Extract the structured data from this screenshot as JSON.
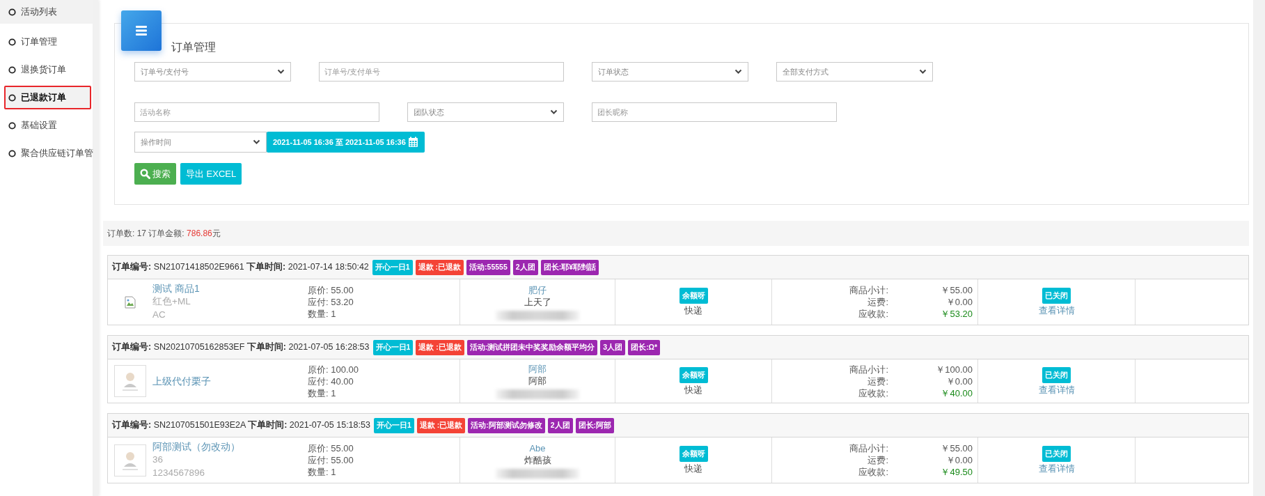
{
  "sidebar": {
    "items": [
      {
        "label": "活动列表",
        "selected": false,
        "hovered": true
      },
      {
        "label": "订单管理",
        "selected": false,
        "hovered": false
      },
      {
        "label": "退换货订单",
        "selected": false,
        "hovered": false
      },
      {
        "label": "已退款订单",
        "selected": true,
        "hovered": false
      },
      {
        "label": "基础设置",
        "selected": false,
        "hovered": false
      },
      {
        "label": "聚合供应链订单管",
        "selected": false,
        "hovered": false
      }
    ]
  },
  "filter_panel": {
    "title": "订单管理",
    "rows": [
      {
        "fields": [
          {
            "kind": "select",
            "placeholder": "订单号/支付号"
          },
          {
            "kind": "input",
            "placeholder": "订单号/支付单号"
          },
          {
            "kind": "select",
            "placeholder": "订单状态"
          },
          {
            "kind": "select",
            "placeholder": "全部支付方式"
          }
        ]
      },
      {
        "fields": [
          {
            "kind": "input",
            "placeholder": "活动名称"
          },
          {
            "kind": "select",
            "placeholder": "团队状态"
          },
          {
            "kind": "input",
            "placeholder": "团长昵称"
          }
        ]
      },
      {
        "fields": [
          {
            "kind": "time-select",
            "placeholder": "操作时间"
          },
          {
            "kind": "date-range",
            "placeholder": "2021-11-05 16:36 至 2021-11-05 16:36"
          }
        ]
      }
    ],
    "buttons": [
      {
        "kind": "search",
        "label": "搜索"
      },
      {
        "kind": "export",
        "label": "导出 EXCEL"
      }
    ]
  },
  "summary": {
    "count_label": "订单数:",
    "count": "17",
    "amount_label": "订单金额:",
    "amount": "786.86",
    "unit": "元"
  },
  "orders": [
    {
      "header": "**订单编号:** SN21071418502E9661 **下单时间:** 2021-07-14 18:50:42",
      "tags": [
        {
          "text": "开心一日1",
          "color": "#00bcd4"
        },
        {
          "text": "退款 :已退款",
          "color": "#f44336"
        },
        {
          "text": "活动:55555",
          "color": "#9c27b0"
        },
        {
          "text": "2人团",
          "color": "#9c27b0"
        },
        {
          "text": "团长:耶¥耶剉話",
          "color": "#9c27b0"
        }
      ],
      "image": {
        "kind": "broken"
      },
      "product": {
        "name": "测试 商品1",
        "details": [
          "红色+ML",
          "AC"
        ]
      },
      "prices": [
        "原价: 55.00",
        "应付: 53.20",
        "数量: 1"
      ],
      "buyer": {
        "name": "肥仔",
        "nickname": "上天了",
        "redacted": true
      },
      "payment": {
        "badge": "余额呀",
        "delivery": "快递"
      },
      "totals": {
        "subtotal": {
          "label": "商品小计:",
          "value": "￥55.00"
        },
        "shipping": {
          "label": "运费:",
          "value": "￥0.00"
        },
        "receivable": {
          "label": "应收款:",
          "value": "￥53.20"
        }
      },
      "status": {
        "badge": "已关闭",
        "link": "查看详情"
      }
    },
    {
      "header": "**订单编号:** SN20210705162853EF **下单时间:** 2021-07-05 16:28:53",
      "tags": [
        {
          "text": "开心一日1",
          "color": "#00bcd4"
        },
        {
          "text": "退款 :已退款",
          "color": "#f44336"
        },
        {
          "text": "活动:测试拼团未中奖奖励余额平均分",
          "color": "#9c27b0"
        },
        {
          "text": "3人团",
          "color": "#9c27b0"
        },
        {
          "text": "团长:Ω*",
          "color": "#9c27b0"
        }
      ],
      "image": {
        "kind": "picture"
      },
      "product": {
        "name": "上级代付栗子"
      },
      "prices": [
        "原价: 100.00",
        "应付: 40.00",
        "数量: 1"
      ],
      "buyer": {
        "name": "阿部",
        "nickname": "阿部",
        "redacted": true
      },
      "payment": {
        "badge": "余额呀",
        "delivery": "快递"
      },
      "totals": {
        "subtotal": {
          "label": "商品小计:",
          "value": "￥100.00"
        },
        "shipping": {
          "label": "运费:",
          "value": "￥0.00"
        },
        "receivable": {
          "label": "应收款:",
          "value": "￥40.00"
        }
      },
      "status": {
        "badge": "已关闭",
        "link": "查看详情"
      }
    },
    {
      "header": "**订单编号:** SN2107051501E93E2A **下单时间:** 2021-07-05 15:18:53",
      "tags": [
        {
          "text": "开心一日1",
          "color": "#00bcd4"
        },
        {
          "text": "退款 :已退款",
          "color": "#f44336"
        },
        {
          "text": "活动:阿部测试勿修改",
          "color": "#9c27b0"
        },
        {
          "text": "2人团",
          "color": "#9c27b0"
        },
        {
          "text": "团长:阿部",
          "color": "#9c27b0"
        }
      ],
      "image": {
        "kind": "picture"
      },
      "product": {
        "name": "阿部测试（勿改动）",
        "details": [
          "36",
          "1234567896"
        ]
      },
      "prices": [
        "原价: 55.00",
        "应付: 55.00",
        "数量: 1"
      ],
      "buyer": {
        "name": "Abe",
        "nickname": "炸酷孩",
        "redacted": true
      },
      "payment": {
        "badge": "余额呀",
        "delivery": "快递"
      },
      "totals": {
        "subtotal": {
          "label": "商品小计:",
          "value": "￥55.00"
        },
        "shipping": {
          "label": "运费:",
          "value": "￥0.00"
        },
        "receivable": {
          "label": "应收款:",
          "value": "￥49.50"
        }
      },
      "status": {
        "badge": "已关闭",
        "link": "查看详情"
      }
    }
  ]
}
